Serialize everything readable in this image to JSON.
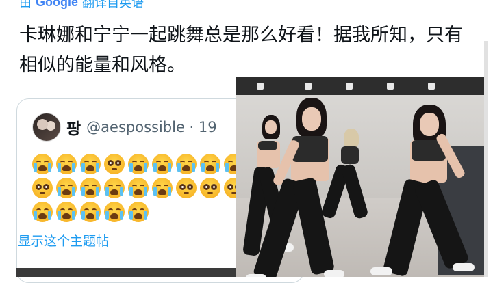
{
  "translate_bar": {
    "prefix": "由",
    "google": "Google",
    "suffix": "翻译自英语"
  },
  "tweet": {
    "text": "卡琳娜和宁宁一起跳舞总是那么好看！据我所知，只有相似的能量和风格。"
  },
  "quote": {
    "display_name": "팡",
    "handle": "@aespossible · 19",
    "emoji_rows": [
      [
        "loudly-crying",
        "loudly-crying",
        "loudly-crying",
        "pleading",
        "loudly-crying",
        "loudly-crying",
        "loudly-crying",
        "loudly-crying",
        "loudly-crying"
      ],
      [
        "pleading",
        "loudly-crying",
        "loudly-crying",
        "loudly-crying",
        "loudly-crying",
        "loudly-crying",
        "pleading",
        "pleading",
        "pleading"
      ],
      [
        "loudly-crying",
        "loudly-crying",
        "loudly-crying",
        "loudly-crying",
        "loudly-crying"
      ]
    ],
    "show_thread": "显示这个主题帖"
  },
  "colors": {
    "link": "#1d9bf0",
    "text": "#0f1419",
    "muted": "#536471",
    "border": "#cfd9de"
  }
}
